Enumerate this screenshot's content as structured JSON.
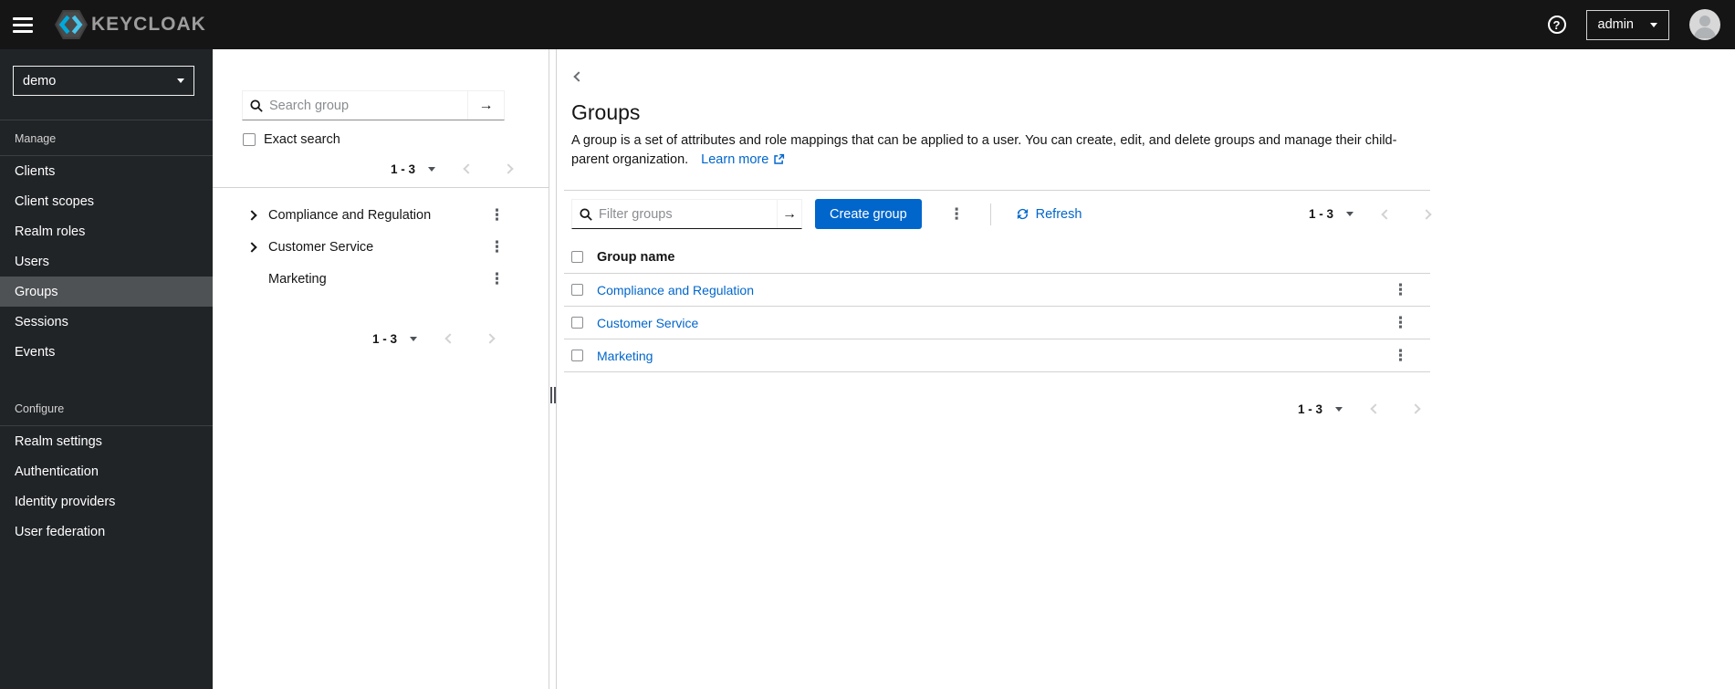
{
  "masthead": {
    "brand_text": "KEYCLOAK",
    "user_label": "admin",
    "help_icon": "question-circle",
    "avatar_icon": "user-avatar"
  },
  "sidebar": {
    "realm_selector_value": "demo",
    "manage_label": "Manage",
    "manage_items": [
      "Clients",
      "Client scopes",
      "Realm roles",
      "Users",
      "Groups",
      "Sessions",
      "Events"
    ],
    "selected_item": "Groups",
    "configure_label": "Configure",
    "configure_items": [
      "Realm settings",
      "Authentication",
      "Identity providers",
      "User federation"
    ]
  },
  "tree_panel": {
    "search_placeholder": "Search group",
    "search_icon": "magnifying-glass",
    "submit_arrow": "→",
    "exact_search_label": "Exact search",
    "top_pagination_range": "1 - 3",
    "items": [
      {
        "label": "Compliance and Regulation",
        "expandable": true
      },
      {
        "label": "Customer Service",
        "expandable": true
      },
      {
        "label": "Marketing",
        "expandable": false
      }
    ],
    "kebab_icon": "⋮",
    "bottom_pagination_range": "1 - 3"
  },
  "main": {
    "title": "Groups",
    "description": "A group is a set of attributes and role mappings that can be applied to a user. You can create, edit, and delete groups and manage their child-parent organization.",
    "learn_more_label": "Learn more",
    "toolbar": {
      "filter_placeholder": "Filter groups",
      "submit_arrow": "→",
      "create_button_label": "Create group",
      "kebab_icon": "⋮",
      "refresh_label": "Refresh",
      "pagination_range": "1 - 3"
    },
    "table": {
      "column_header": "Group name",
      "rows": [
        {
          "name": "Compliance and Regulation"
        },
        {
          "name": "Customer Service"
        },
        {
          "name": "Marketing"
        }
      ],
      "row_kebab_icon": "⋮"
    },
    "bottom_pagination_range": "1 - 3"
  },
  "colors": {
    "accent": "#0066cc",
    "link": "#0066cc",
    "masthead_bg": "#151515",
    "sidebar_bg": "#212427",
    "sidebar_selected_bg": "#4f5255",
    "border": "#d2d2d2",
    "muted_text": "#6a6e73"
  }
}
